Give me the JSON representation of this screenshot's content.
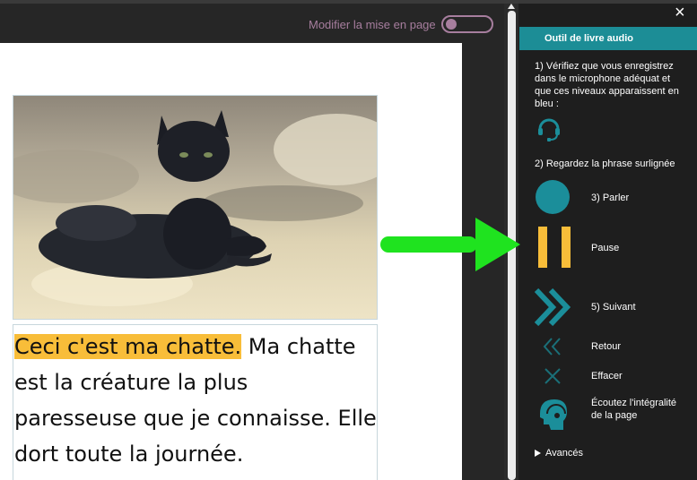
{
  "toolbar": {
    "layout_toggle_label": "Modifier la mise en page",
    "layout_toggle_state": "off"
  },
  "page": {
    "sentence_highlighted": "Ceci c'est ma chatte.",
    "sentence_rest": " Ma chatte est la créature la plus paresseuse que je connaisse. Elle dort toute la journée.",
    "image_subject": "black-cat-photo"
  },
  "panel": {
    "close_label": "×",
    "title": "Outil de livre audio",
    "step1": "1) Vérifiez que vous enregistrez dans le microphone adéquat et que ces niveaux apparaissent en bleu :",
    "step2": "2) Regardez la phrase surlignée",
    "record_label": "3) Parler",
    "pause_label": "Pause",
    "next_label": "5) Suivant",
    "back_label": "Retour",
    "clear_label": "Effacer",
    "listen_label": "Écoutez l'intégralité de la page",
    "advanced_label": "Avancés",
    "icons": [
      "headset-mic-icon",
      "record-icon",
      "pause-icon",
      "next-icon",
      "back-icon",
      "clear-icon",
      "listen-page-icon"
    ]
  },
  "colors": {
    "accent_teal": "#1b8e9a",
    "highlight": "#f8bd39",
    "pause": "#f8bd39",
    "toggle": "#a77e9e",
    "pointer_arrow": "#1fe31f"
  }
}
